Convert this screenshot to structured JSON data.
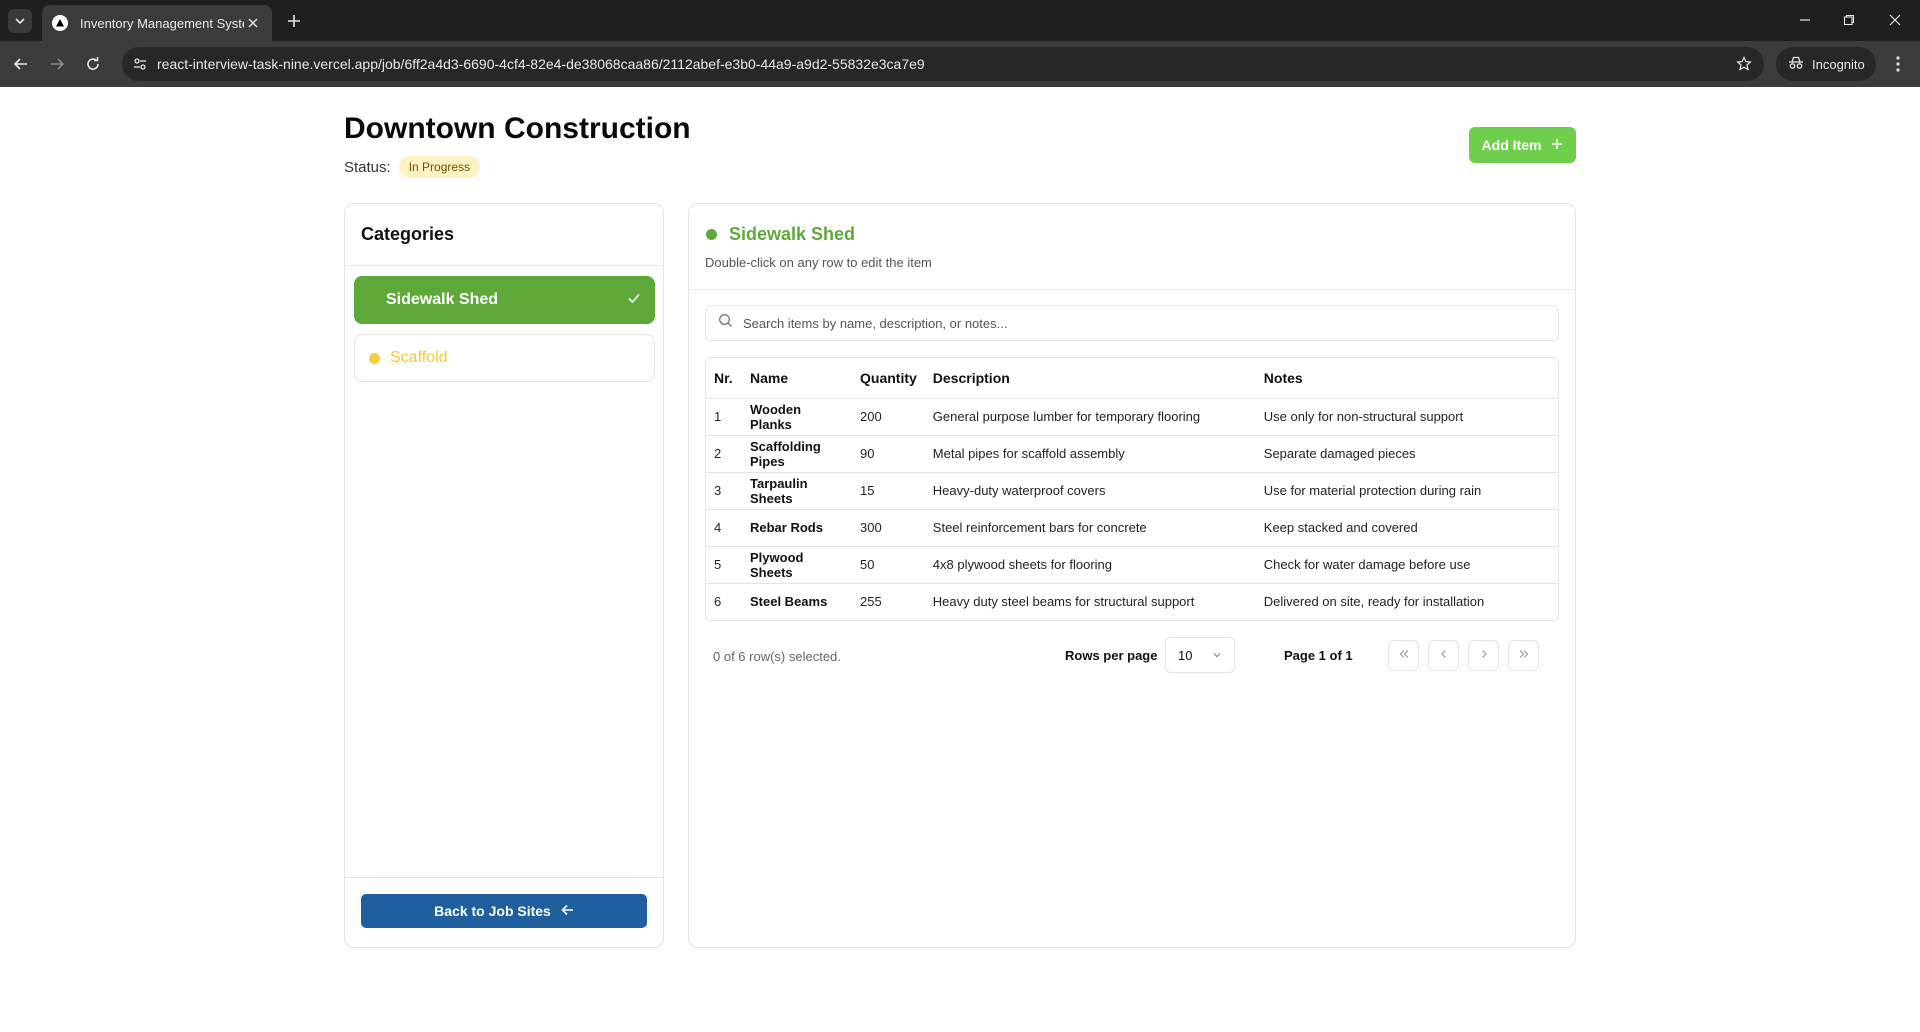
{
  "browser": {
    "tab_title": "Inventory Management System",
    "url": "react-interview-task-nine.vercel.app/job/6ff2a4d3-6690-4cf4-82e4-de38068caa86/2112abef-e3b0-44a9-a9d2-55832e3ca7e9",
    "incognito_label": "Incognito"
  },
  "page": {
    "title": "Downtown Construction",
    "status_label": "Status:",
    "status_value": "In Progress",
    "add_item_label": "Add Item"
  },
  "categories": {
    "header": "Categories",
    "items": [
      {
        "label": "Sidewalk Shed",
        "active": true
      },
      {
        "label": "Scaffold",
        "active": false
      }
    ],
    "back_label": "Back to Job Sites"
  },
  "items_panel": {
    "title": "Sidewalk Shed",
    "subtitle": "Double-click on any row to edit the item",
    "search_placeholder": "Search items by name, description, or notes...",
    "columns": [
      "Nr.",
      "Name",
      "Quantity",
      "Description",
      "Notes"
    ],
    "rows": [
      {
        "nr": "1",
        "name": "Wooden Planks",
        "quantity": "200",
        "description": "General purpose lumber for temporary flooring",
        "notes": "Use only for non-structural support"
      },
      {
        "nr": "2",
        "name": "Scaffolding Pipes",
        "quantity": "90",
        "description": "Metal pipes for scaffold assembly",
        "notes": "Separate damaged pieces"
      },
      {
        "nr": "3",
        "name": "Tarpaulin Sheets",
        "quantity": "15",
        "description": "Heavy-duty waterproof covers",
        "notes": "Use for material protection during rain"
      },
      {
        "nr": "4",
        "name": "Rebar Rods",
        "quantity": "300",
        "description": "Steel reinforcement bars for concrete",
        "notes": "Keep stacked and covered"
      },
      {
        "nr": "5",
        "name": "Plywood Sheets",
        "quantity": "50",
        "description": "4x8 plywood sheets for flooring",
        "notes": "Check for water damage before use"
      },
      {
        "nr": "6",
        "name": "Steel Beams",
        "quantity": "255",
        "description": "Heavy duty steel beams for structural support",
        "notes": "Delivered on site, ready for installation"
      }
    ],
    "selection_info": "0 of 6 row(s) selected.",
    "rows_per_page_label": "Rows per page",
    "rows_per_page_value": "10",
    "page_info": "Page 1 of 1"
  },
  "colors": {
    "accent_green": "#5fa83a",
    "add_button_green": "#6fce4b",
    "scaffold_yellow": "#f4c92f",
    "back_button_blue": "#1f5f9e",
    "status_badge_bg": "#fdf2c4"
  }
}
